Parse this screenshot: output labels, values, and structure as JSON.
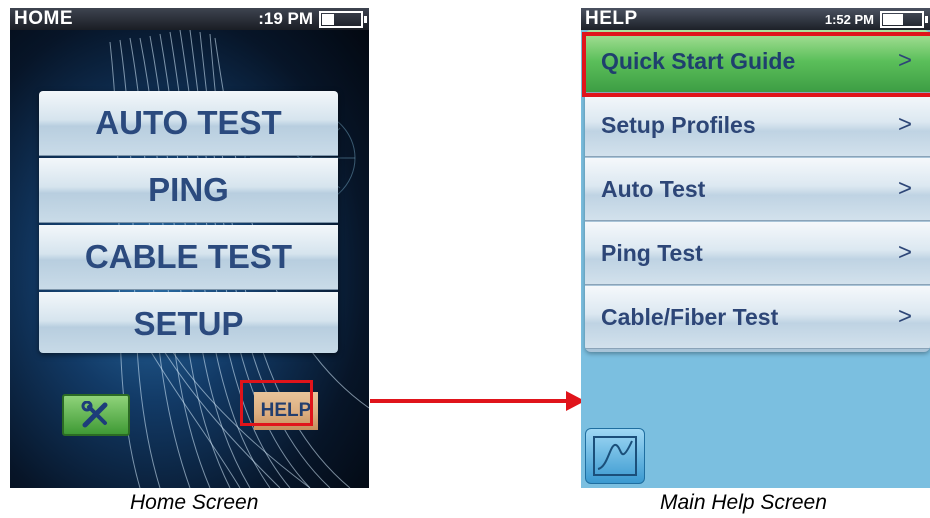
{
  "home": {
    "title": "HOME",
    "time": ":19 PM",
    "battery_level": 0.3,
    "menu": [
      "AUTO TEST",
      "PING",
      "CABLE TEST",
      "SETUP"
    ],
    "help_label": "HELP",
    "caption": "Home Screen"
  },
  "help": {
    "title": "HELP",
    "time": "1:52 PM",
    "battery_level": 0.5,
    "items": [
      {
        "label": "Quick Start Guide",
        "chevron": ">"
      },
      {
        "label": "Setup Profiles",
        "chevron": ">"
      },
      {
        "label": "Auto Test",
        "chevron": ">"
      },
      {
        "label": "Ping Test",
        "chevron": ">"
      },
      {
        "label": "Cable/Fiber Test",
        "chevron": ">"
      }
    ],
    "caption": "Main Help Screen"
  },
  "colors": {
    "highlight": "#e0141b",
    "button_text": "#2b4a7e",
    "active_item": "#5bbf5a"
  }
}
